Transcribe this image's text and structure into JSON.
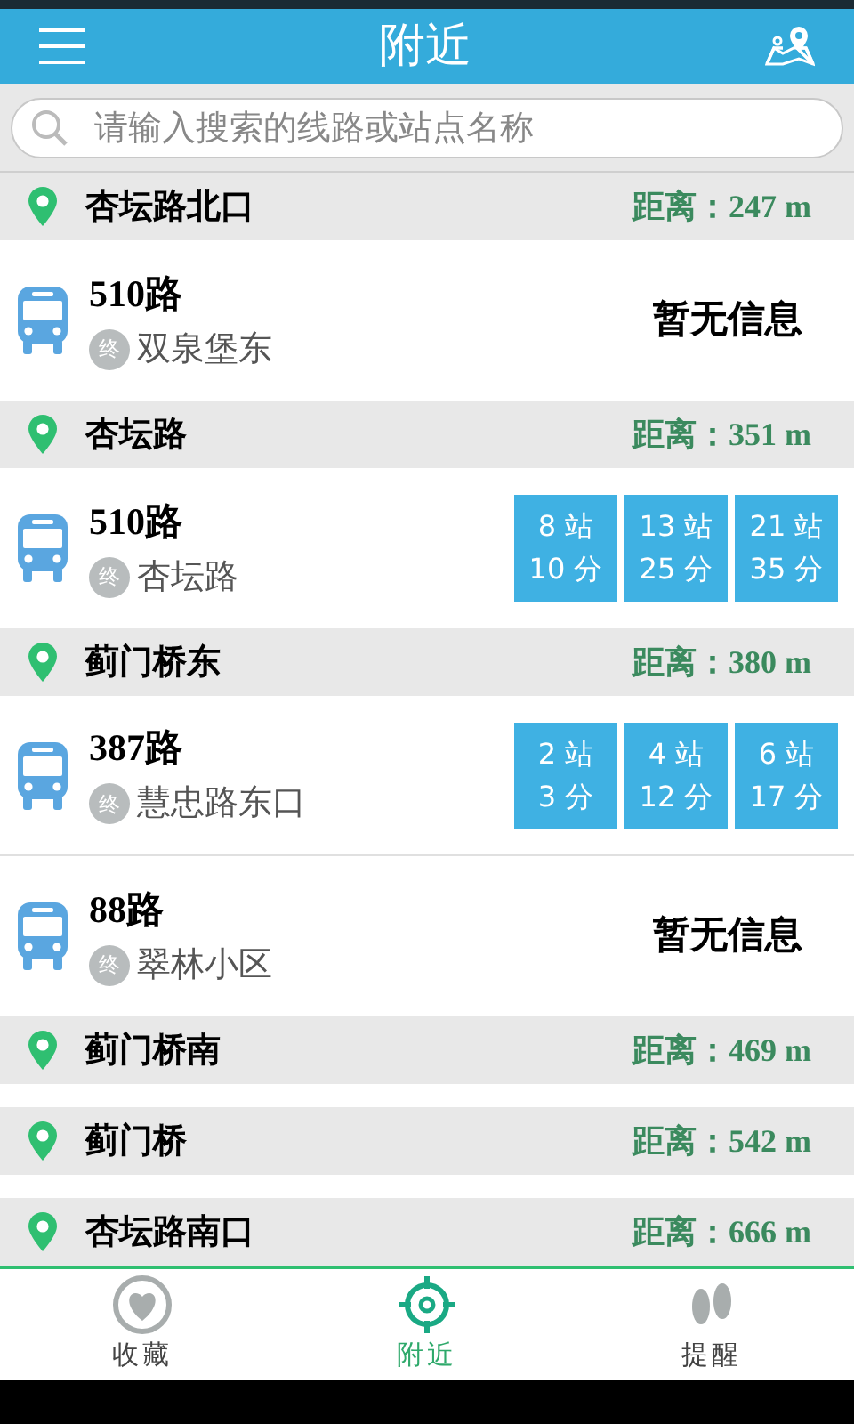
{
  "header": {
    "title": "附近"
  },
  "search": {
    "placeholder": "请输入搜索的线路或站点名称"
  },
  "stops": [
    {
      "name": "杏坛路北口",
      "distance": "距离：247 m",
      "routes": [
        {
          "name": "510路",
          "terminal_mark": "终",
          "terminal": "双泉堡东",
          "kind": "no_info",
          "status": "暂无信息"
        }
      ]
    },
    {
      "name": "杏坛路",
      "distance": "距离：351 m",
      "routes": [
        {
          "name": "510路",
          "terminal_mark": "终",
          "terminal": "杏坛路",
          "kind": "arrivals",
          "buses": [
            {
              "stops": "8 站",
              "minutes": "10 分"
            },
            {
              "stops": "13 站",
              "minutes": "25 分"
            },
            {
              "stops": "21 站",
              "minutes": "35 分"
            }
          ]
        }
      ]
    },
    {
      "name": "蓟门桥东",
      "distance": "距离：380 m",
      "routes": [
        {
          "name": "387路",
          "terminal_mark": "终",
          "terminal": "慧忠路东口",
          "kind": "arrivals",
          "buses": [
            {
              "stops": "2 站",
              "minutes": "3 分"
            },
            {
              "stops": "4 站",
              "minutes": "12 分"
            },
            {
              "stops": "6 站",
              "minutes": "17 分"
            }
          ]
        },
        {
          "name": "88路",
          "terminal_mark": "终",
          "terminal": "翠林小区",
          "kind": "no_info",
          "status": "暂无信息"
        }
      ]
    },
    {
      "name": "蓟门桥南",
      "distance": "距离：469 m"
    },
    {
      "name": "蓟门桥",
      "distance": "距离：542 m"
    },
    {
      "name": "杏坛路南口",
      "distance": "距离：666 m"
    }
  ],
  "tabs": [
    {
      "label": "收藏",
      "kind": "favorites",
      "selected": false
    },
    {
      "label": "附近",
      "kind": "nearby",
      "selected": true
    },
    {
      "label": "提醒",
      "kind": "reminder",
      "selected": false
    }
  ]
}
